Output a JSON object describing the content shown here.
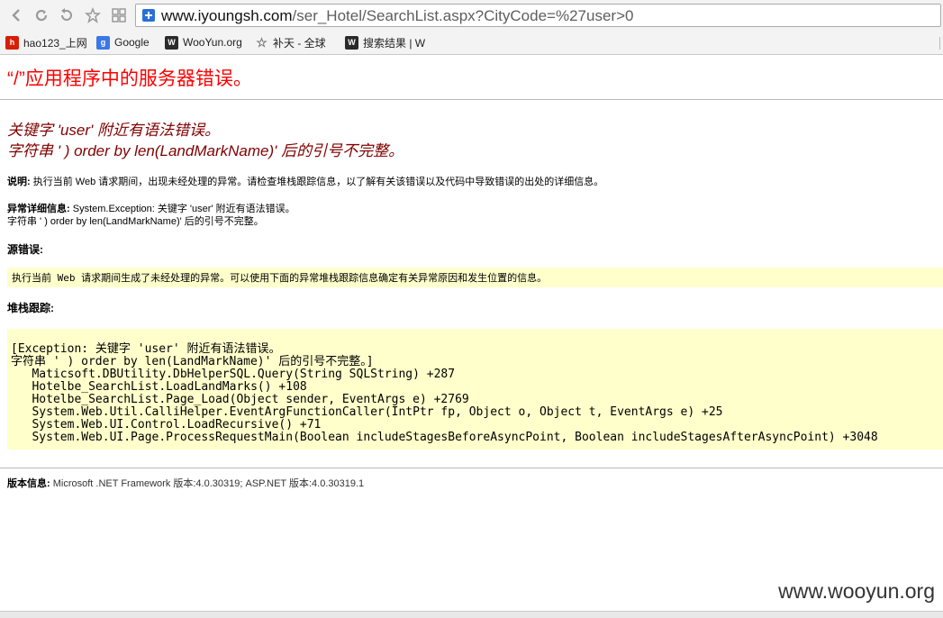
{
  "browser": {
    "url_domain": "www.iyoungsh.com",
    "url_path": "/ser_Hotel/SearchList.aspx?CityCode=%27user>0",
    "bookmarks": [
      {
        "label": "hao123_上网",
        "icon": "hao123-icon",
        "color": "#d81e06"
      },
      {
        "label": "Google",
        "icon": "google-icon",
        "color": "#3b78e7"
      },
      {
        "label": "WooYun.org",
        "icon": "wooyun-icon",
        "color": "#2a2a2a"
      },
      {
        "label": "补天 - 全球",
        "icon": "star-icon",
        "color": "#888888"
      },
      {
        "label": "搜索结果 | W",
        "icon": "wooyun-icon",
        "color": "#2a2a2a"
      }
    ]
  },
  "page": {
    "title": "“/”应用程序中的服务器错误。",
    "error_line1": "关键字 'user' 附近有语法错误。",
    "error_line2": "字符串 ' ) order by len(LandMarkName)' 后的引号不完整。",
    "description_label": "说明:",
    "description_text": " 执行当前 Web 请求期间，出现未经处理的异常。请检查堆栈跟踪信息，以了解有关该错误以及代码中导致错误的出处的详细信息。",
    "exception_label": "异常详细信息:",
    "exception_line1": " System.Exception: 关键字 'user' 附近有语法错误。",
    "exception_line2": "字符串 ' ) order by len(LandMarkName)' 后的引号不完整。",
    "source_label": "源错误:",
    "source_text": "执行当前 Web 请求期间生成了未经处理的异常。可以使用下面的异常堆栈跟踪信息确定有关异常原因和发生位置的信息。",
    "stack_label": "堆栈跟踪:",
    "stack_lines": [
      "[Exception: 关键字 'user' 附近有语法错误。",
      "字符串 ' ) order by len(LandMarkName)' 后的引号不完整。]",
      "   Maticsoft.DBUtility.DbHelperSQL.Query(String SQLString) +287",
      "   Hotelbe_SearchList.LoadLandMarks() +108",
      "   Hotelbe_SearchList.Page_Load(Object sender, EventArgs e) +2769",
      "   System.Web.Util.CalliHelper.EventArgFunctionCaller(IntPtr fp, Object o, Object t, EventArgs e) +25",
      "   System.Web.UI.Control.LoadRecursive() +71",
      "   System.Web.UI.Page.ProcessRequestMain(Boolean includeStagesBeforeAsyncPoint, Boolean includeStagesAfterAsyncPoint) +3048"
    ],
    "version_label": "版本信息:",
    "version_text": " Microsoft .NET Framework 版本:4.0.30319; ASP.NET 版本:4.0.30319.1"
  },
  "watermark": "www.wooyun.org",
  "colors": {
    "title_red": "#ff0000",
    "error_maroon": "#800000",
    "code_bg": "#ffffcc"
  }
}
